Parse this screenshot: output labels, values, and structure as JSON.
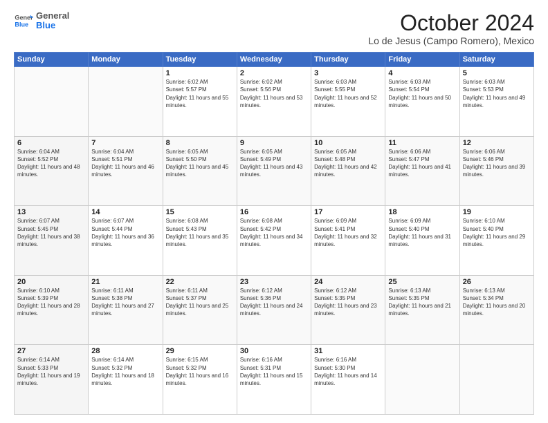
{
  "header": {
    "logo_general": "General",
    "logo_blue": "Blue",
    "title": "October 2024",
    "subtitle": "Lo de Jesus (Campo Romero), Mexico"
  },
  "days_of_week": [
    "Sunday",
    "Monday",
    "Tuesday",
    "Wednesday",
    "Thursday",
    "Friday",
    "Saturday"
  ],
  "weeks": [
    [
      {
        "day": "",
        "sunrise": "",
        "sunset": "",
        "daylight": ""
      },
      {
        "day": "",
        "sunrise": "",
        "sunset": "",
        "daylight": ""
      },
      {
        "day": "1",
        "sunrise": "Sunrise: 6:02 AM",
        "sunset": "Sunset: 5:57 PM",
        "daylight": "Daylight: 11 hours and 55 minutes."
      },
      {
        "day": "2",
        "sunrise": "Sunrise: 6:02 AM",
        "sunset": "Sunset: 5:56 PM",
        "daylight": "Daylight: 11 hours and 53 minutes."
      },
      {
        "day": "3",
        "sunrise": "Sunrise: 6:03 AM",
        "sunset": "Sunset: 5:55 PM",
        "daylight": "Daylight: 11 hours and 52 minutes."
      },
      {
        "day": "4",
        "sunrise": "Sunrise: 6:03 AM",
        "sunset": "Sunset: 5:54 PM",
        "daylight": "Daylight: 11 hours and 50 minutes."
      },
      {
        "day": "5",
        "sunrise": "Sunrise: 6:03 AM",
        "sunset": "Sunset: 5:53 PM",
        "daylight": "Daylight: 11 hours and 49 minutes."
      }
    ],
    [
      {
        "day": "6",
        "sunrise": "Sunrise: 6:04 AM",
        "sunset": "Sunset: 5:52 PM",
        "daylight": "Daylight: 11 hours and 48 minutes."
      },
      {
        "day": "7",
        "sunrise": "Sunrise: 6:04 AM",
        "sunset": "Sunset: 5:51 PM",
        "daylight": "Daylight: 11 hours and 46 minutes."
      },
      {
        "day": "8",
        "sunrise": "Sunrise: 6:05 AM",
        "sunset": "Sunset: 5:50 PM",
        "daylight": "Daylight: 11 hours and 45 minutes."
      },
      {
        "day": "9",
        "sunrise": "Sunrise: 6:05 AM",
        "sunset": "Sunset: 5:49 PM",
        "daylight": "Daylight: 11 hours and 43 minutes."
      },
      {
        "day": "10",
        "sunrise": "Sunrise: 6:05 AM",
        "sunset": "Sunset: 5:48 PM",
        "daylight": "Daylight: 11 hours and 42 minutes."
      },
      {
        "day": "11",
        "sunrise": "Sunrise: 6:06 AM",
        "sunset": "Sunset: 5:47 PM",
        "daylight": "Daylight: 11 hours and 41 minutes."
      },
      {
        "day": "12",
        "sunrise": "Sunrise: 6:06 AM",
        "sunset": "Sunset: 5:46 PM",
        "daylight": "Daylight: 11 hours and 39 minutes."
      }
    ],
    [
      {
        "day": "13",
        "sunrise": "Sunrise: 6:07 AM",
        "sunset": "Sunset: 5:45 PM",
        "daylight": "Daylight: 11 hours and 38 minutes."
      },
      {
        "day": "14",
        "sunrise": "Sunrise: 6:07 AM",
        "sunset": "Sunset: 5:44 PM",
        "daylight": "Daylight: 11 hours and 36 minutes."
      },
      {
        "day": "15",
        "sunrise": "Sunrise: 6:08 AM",
        "sunset": "Sunset: 5:43 PM",
        "daylight": "Daylight: 11 hours and 35 minutes."
      },
      {
        "day": "16",
        "sunrise": "Sunrise: 6:08 AM",
        "sunset": "Sunset: 5:42 PM",
        "daylight": "Daylight: 11 hours and 34 minutes."
      },
      {
        "day": "17",
        "sunrise": "Sunrise: 6:09 AM",
        "sunset": "Sunset: 5:41 PM",
        "daylight": "Daylight: 11 hours and 32 minutes."
      },
      {
        "day": "18",
        "sunrise": "Sunrise: 6:09 AM",
        "sunset": "Sunset: 5:40 PM",
        "daylight": "Daylight: 11 hours and 31 minutes."
      },
      {
        "day": "19",
        "sunrise": "Sunrise: 6:10 AM",
        "sunset": "Sunset: 5:40 PM",
        "daylight": "Daylight: 11 hours and 29 minutes."
      }
    ],
    [
      {
        "day": "20",
        "sunrise": "Sunrise: 6:10 AM",
        "sunset": "Sunset: 5:39 PM",
        "daylight": "Daylight: 11 hours and 28 minutes."
      },
      {
        "day": "21",
        "sunrise": "Sunrise: 6:11 AM",
        "sunset": "Sunset: 5:38 PM",
        "daylight": "Daylight: 11 hours and 27 minutes."
      },
      {
        "day": "22",
        "sunrise": "Sunrise: 6:11 AM",
        "sunset": "Sunset: 5:37 PM",
        "daylight": "Daylight: 11 hours and 25 minutes."
      },
      {
        "day": "23",
        "sunrise": "Sunrise: 6:12 AM",
        "sunset": "Sunset: 5:36 PM",
        "daylight": "Daylight: 11 hours and 24 minutes."
      },
      {
        "day": "24",
        "sunrise": "Sunrise: 6:12 AM",
        "sunset": "Sunset: 5:35 PM",
        "daylight": "Daylight: 11 hours and 23 minutes."
      },
      {
        "day": "25",
        "sunrise": "Sunrise: 6:13 AM",
        "sunset": "Sunset: 5:35 PM",
        "daylight": "Daylight: 11 hours and 21 minutes."
      },
      {
        "day": "26",
        "sunrise": "Sunrise: 6:13 AM",
        "sunset": "Sunset: 5:34 PM",
        "daylight": "Daylight: 11 hours and 20 minutes."
      }
    ],
    [
      {
        "day": "27",
        "sunrise": "Sunrise: 6:14 AM",
        "sunset": "Sunset: 5:33 PM",
        "daylight": "Daylight: 11 hours and 19 minutes."
      },
      {
        "day": "28",
        "sunrise": "Sunrise: 6:14 AM",
        "sunset": "Sunset: 5:32 PM",
        "daylight": "Daylight: 11 hours and 18 minutes."
      },
      {
        "day": "29",
        "sunrise": "Sunrise: 6:15 AM",
        "sunset": "Sunset: 5:32 PM",
        "daylight": "Daylight: 11 hours and 16 minutes."
      },
      {
        "day": "30",
        "sunrise": "Sunrise: 6:16 AM",
        "sunset": "Sunset: 5:31 PM",
        "daylight": "Daylight: 11 hours and 15 minutes."
      },
      {
        "day": "31",
        "sunrise": "Sunrise: 6:16 AM",
        "sunset": "Sunset: 5:30 PM",
        "daylight": "Daylight: 11 hours and 14 minutes."
      },
      {
        "day": "",
        "sunrise": "",
        "sunset": "",
        "daylight": ""
      },
      {
        "day": "",
        "sunrise": "",
        "sunset": "",
        "daylight": ""
      }
    ]
  ]
}
